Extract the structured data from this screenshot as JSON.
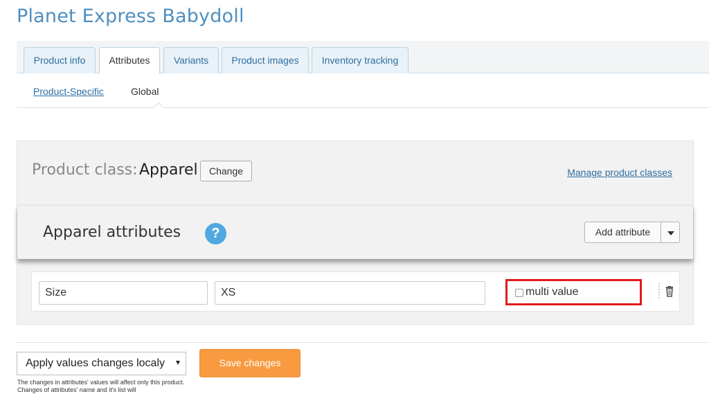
{
  "page": {
    "title": "Planet Express Babydoll"
  },
  "tabs": [
    {
      "label": "Product info"
    },
    {
      "label": "Attributes"
    },
    {
      "label": "Variants"
    },
    {
      "label": "Product images"
    },
    {
      "label": "Inventory tracking"
    }
  ],
  "subtabs": {
    "product_specific": "Product-Specific",
    "global": "Global"
  },
  "product_class": {
    "label": "Product class:",
    "value": "Apparel",
    "change_label": "Change",
    "manage_link": "Manage product classes"
  },
  "attributes": {
    "title": "Apparel attributes",
    "help_icon": "?",
    "add_label": "Add attribute",
    "rows": [
      {
        "name": "Size",
        "value": "XS",
        "multi_label": "multi value",
        "multi_checked": false
      }
    ]
  },
  "footer": {
    "apply_select": "Apply values changes localy",
    "save_label": "Save changes",
    "note": "The changes in attributes' values will affect only this product. Changes of attributes' name and it's list will"
  },
  "colors": {
    "accent": "#4f8fbf",
    "save": "#f79a40",
    "highlight": "#e01b1b",
    "help": "#52a8e0"
  },
  "icons": [
    "question-circle-icon",
    "chevron-down-icon",
    "drag-handle-icon",
    "trash-icon",
    "checkbox-icon"
  ]
}
